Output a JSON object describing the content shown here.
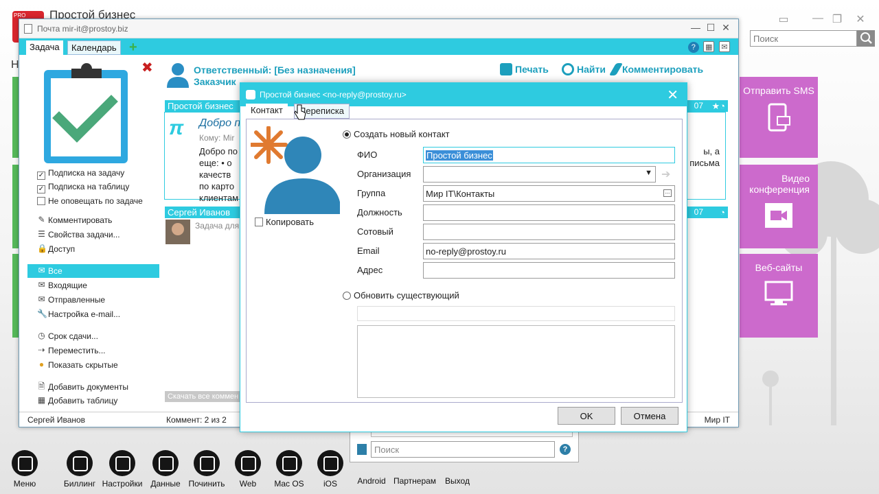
{
  "desktop": {
    "title": "Простой бизнес",
    "logo_text": "PRO",
    "left_cut_letter": "Н",
    "search_placeholder": "Поиск",
    "tiles": [
      {
        "label": "Отправить SMS",
        "icon": "phone-sms-icon"
      },
      {
        "label": "Видео\nконференция",
        "icon": "video-camera-icon"
      },
      {
        "label": "Веб-сайты",
        "icon": "monitor-icon"
      }
    ],
    "dock": [
      "Меню",
      "Биллинг",
      "Настройки",
      "Данные",
      "Починить",
      "Web",
      "Mac OS",
      "iOS",
      "Android",
      "Партнерам",
      "Выход"
    ]
  },
  "mail_window": {
    "title": "Почта mir-it@prostoy.biz",
    "tabs": [
      "Задача",
      "Календарь"
    ],
    "add_tab": "+",
    "checkboxes": [
      {
        "label": "Подписка на задачу",
        "checked": true
      },
      {
        "label": "Подписка на таблицу",
        "checked": true
      },
      {
        "label": "Не оповещать по задаче",
        "checked": false
      }
    ],
    "menu_group1": [
      "Комментировать",
      "Свойства задачи...",
      "Доступ"
    ],
    "menu_group2": [
      "Все",
      "Входящие",
      "Отправленные",
      "Настройка e-mail..."
    ],
    "menu_group3": [
      "Срок сдачи...",
      "Переместить...",
      "Показать скрытые"
    ],
    "menu_group4": [
      "Добавить документы",
      "Добавить таблицу"
    ],
    "responsible": "Ответственный: [Без назначения]",
    "customer": "Заказчик",
    "actions": [
      "Печать",
      "Найти",
      "Комментировать"
    ],
    "message1": {
      "sender": "Простой бизнес",
      "date_fragment": "07",
      "subject": "Добро п",
      "to": "Кому: Mir",
      "body": [
        "Добро по",
        "еще: • о",
        "качеств",
        "по карто",
        "клиентам"
      ],
      "body_right": [
        "ы, а",
        "",
        "письма"
      ]
    },
    "message2": {
      "sender": "Сергей Иванов",
      "date_fragment": "07",
      "preview": "Задача для"
    },
    "copy_all": "Скачать все коммен",
    "status": {
      "user": "Сергей Иванов",
      "comments": "Коммент: 2 из 2",
      "company": "Мир IT"
    }
  },
  "dialog": {
    "title": "Простой бизнес <no-reply@prostoy.ru>",
    "tabs": [
      "Контакт",
      "Переписка"
    ],
    "copy_label": "Копировать",
    "create_new": "Создать новый контакт",
    "update_existing": "Обновить существующий",
    "fields": [
      {
        "label": "ФИО",
        "value": "Простой бизнес"
      },
      {
        "label": "Организация",
        "value": ""
      },
      {
        "label": "Группа",
        "value": "Мир IT\\Контакты"
      },
      {
        "label": "Должность",
        "value": ""
      },
      {
        "label": "Сотовый",
        "value": ""
      },
      {
        "label": "Email",
        "value": "no-reply@prostoy.ru"
      },
      {
        "label": "Адрес",
        "value": ""
      }
    ],
    "ok": "OK",
    "cancel": "Отмена"
  },
  "lower_panel": {
    "search_placeholder": "Поиск"
  },
  "colors": {
    "accent": "#2ecbe0",
    "link": "#1c9fbd",
    "tile": "#cc6acc",
    "close": "#c81f1f",
    "check": "#4aa87a"
  }
}
